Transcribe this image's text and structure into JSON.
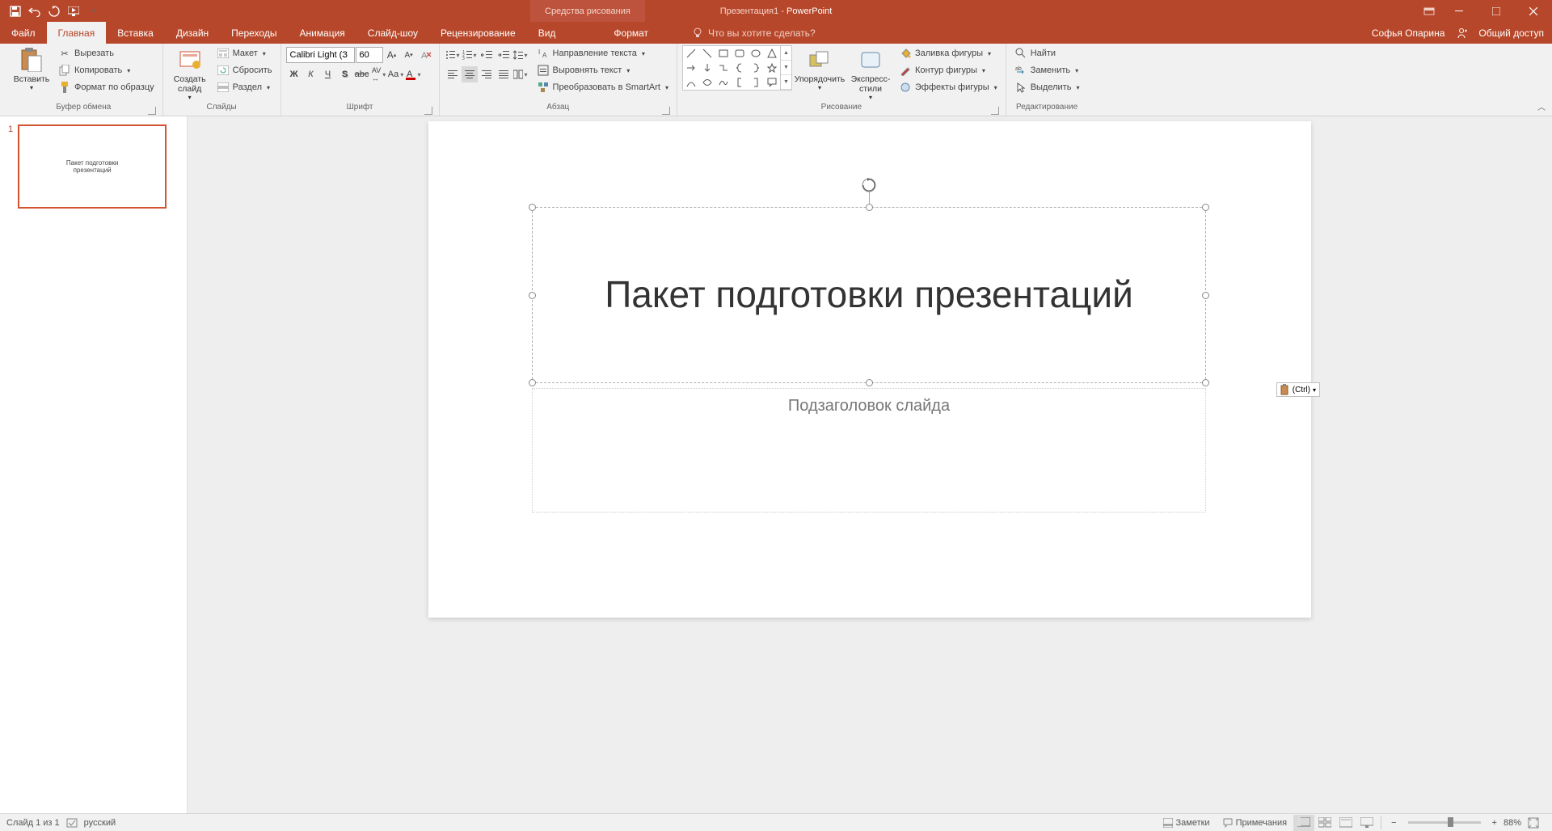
{
  "titlebar": {
    "doc": "Презентация1",
    "app": "PowerPoint",
    "tooltab": "Средства рисования"
  },
  "tabs": {
    "file": "Файл",
    "home": "Главная",
    "insert": "Вставка",
    "design": "Дизайн",
    "transitions": "Переходы",
    "animations": "Анимация",
    "slideshow": "Слайд-шоу",
    "review": "Рецензирование",
    "view": "Вид",
    "format": "Формат",
    "tellme": "Что вы хотите сделать?",
    "user": "Софья Опарина",
    "share": "Общий доступ"
  },
  "ribbon": {
    "clipboard": {
      "label": "Буфер обмена",
      "paste": "Вставить",
      "cut": "Вырезать",
      "copy": "Копировать",
      "formatpainter": "Формат по образцу"
    },
    "slides": {
      "label": "Слайды",
      "newslide": "Создать слайд",
      "layout": "Макет",
      "reset": "Сбросить",
      "section": "Раздел"
    },
    "font": {
      "label": "Шрифт",
      "name": "Calibri Light (З",
      "size": "60"
    },
    "paragraph": {
      "label": "Абзац",
      "textdir": "Направление текста",
      "align": "Выровнять текст",
      "smartart": "Преобразовать в SmartArt"
    },
    "drawing": {
      "label": "Рисование",
      "arrange": "Упорядочить",
      "styles": "Экспресс-стили",
      "fill": "Заливка фигуры",
      "outline": "Контур фигуры",
      "effects": "Эффекты фигуры"
    },
    "editing": {
      "label": "Редактирование",
      "find": "Найти",
      "replace": "Заменить",
      "select": "Выделить"
    }
  },
  "slide": {
    "num": "1",
    "title": "Пакет подготовки презентаций",
    "subtitle": "Подзаголовок слайда",
    "thumb_l1": "Пакет подготовки",
    "thumb_l2": "презентаций",
    "paste_hint": "(Ctrl)"
  },
  "status": {
    "slidepos": "Слайд 1 из 1",
    "lang": "русский",
    "notes": "Заметки",
    "comments": "Примечания",
    "zoom": "88%"
  }
}
